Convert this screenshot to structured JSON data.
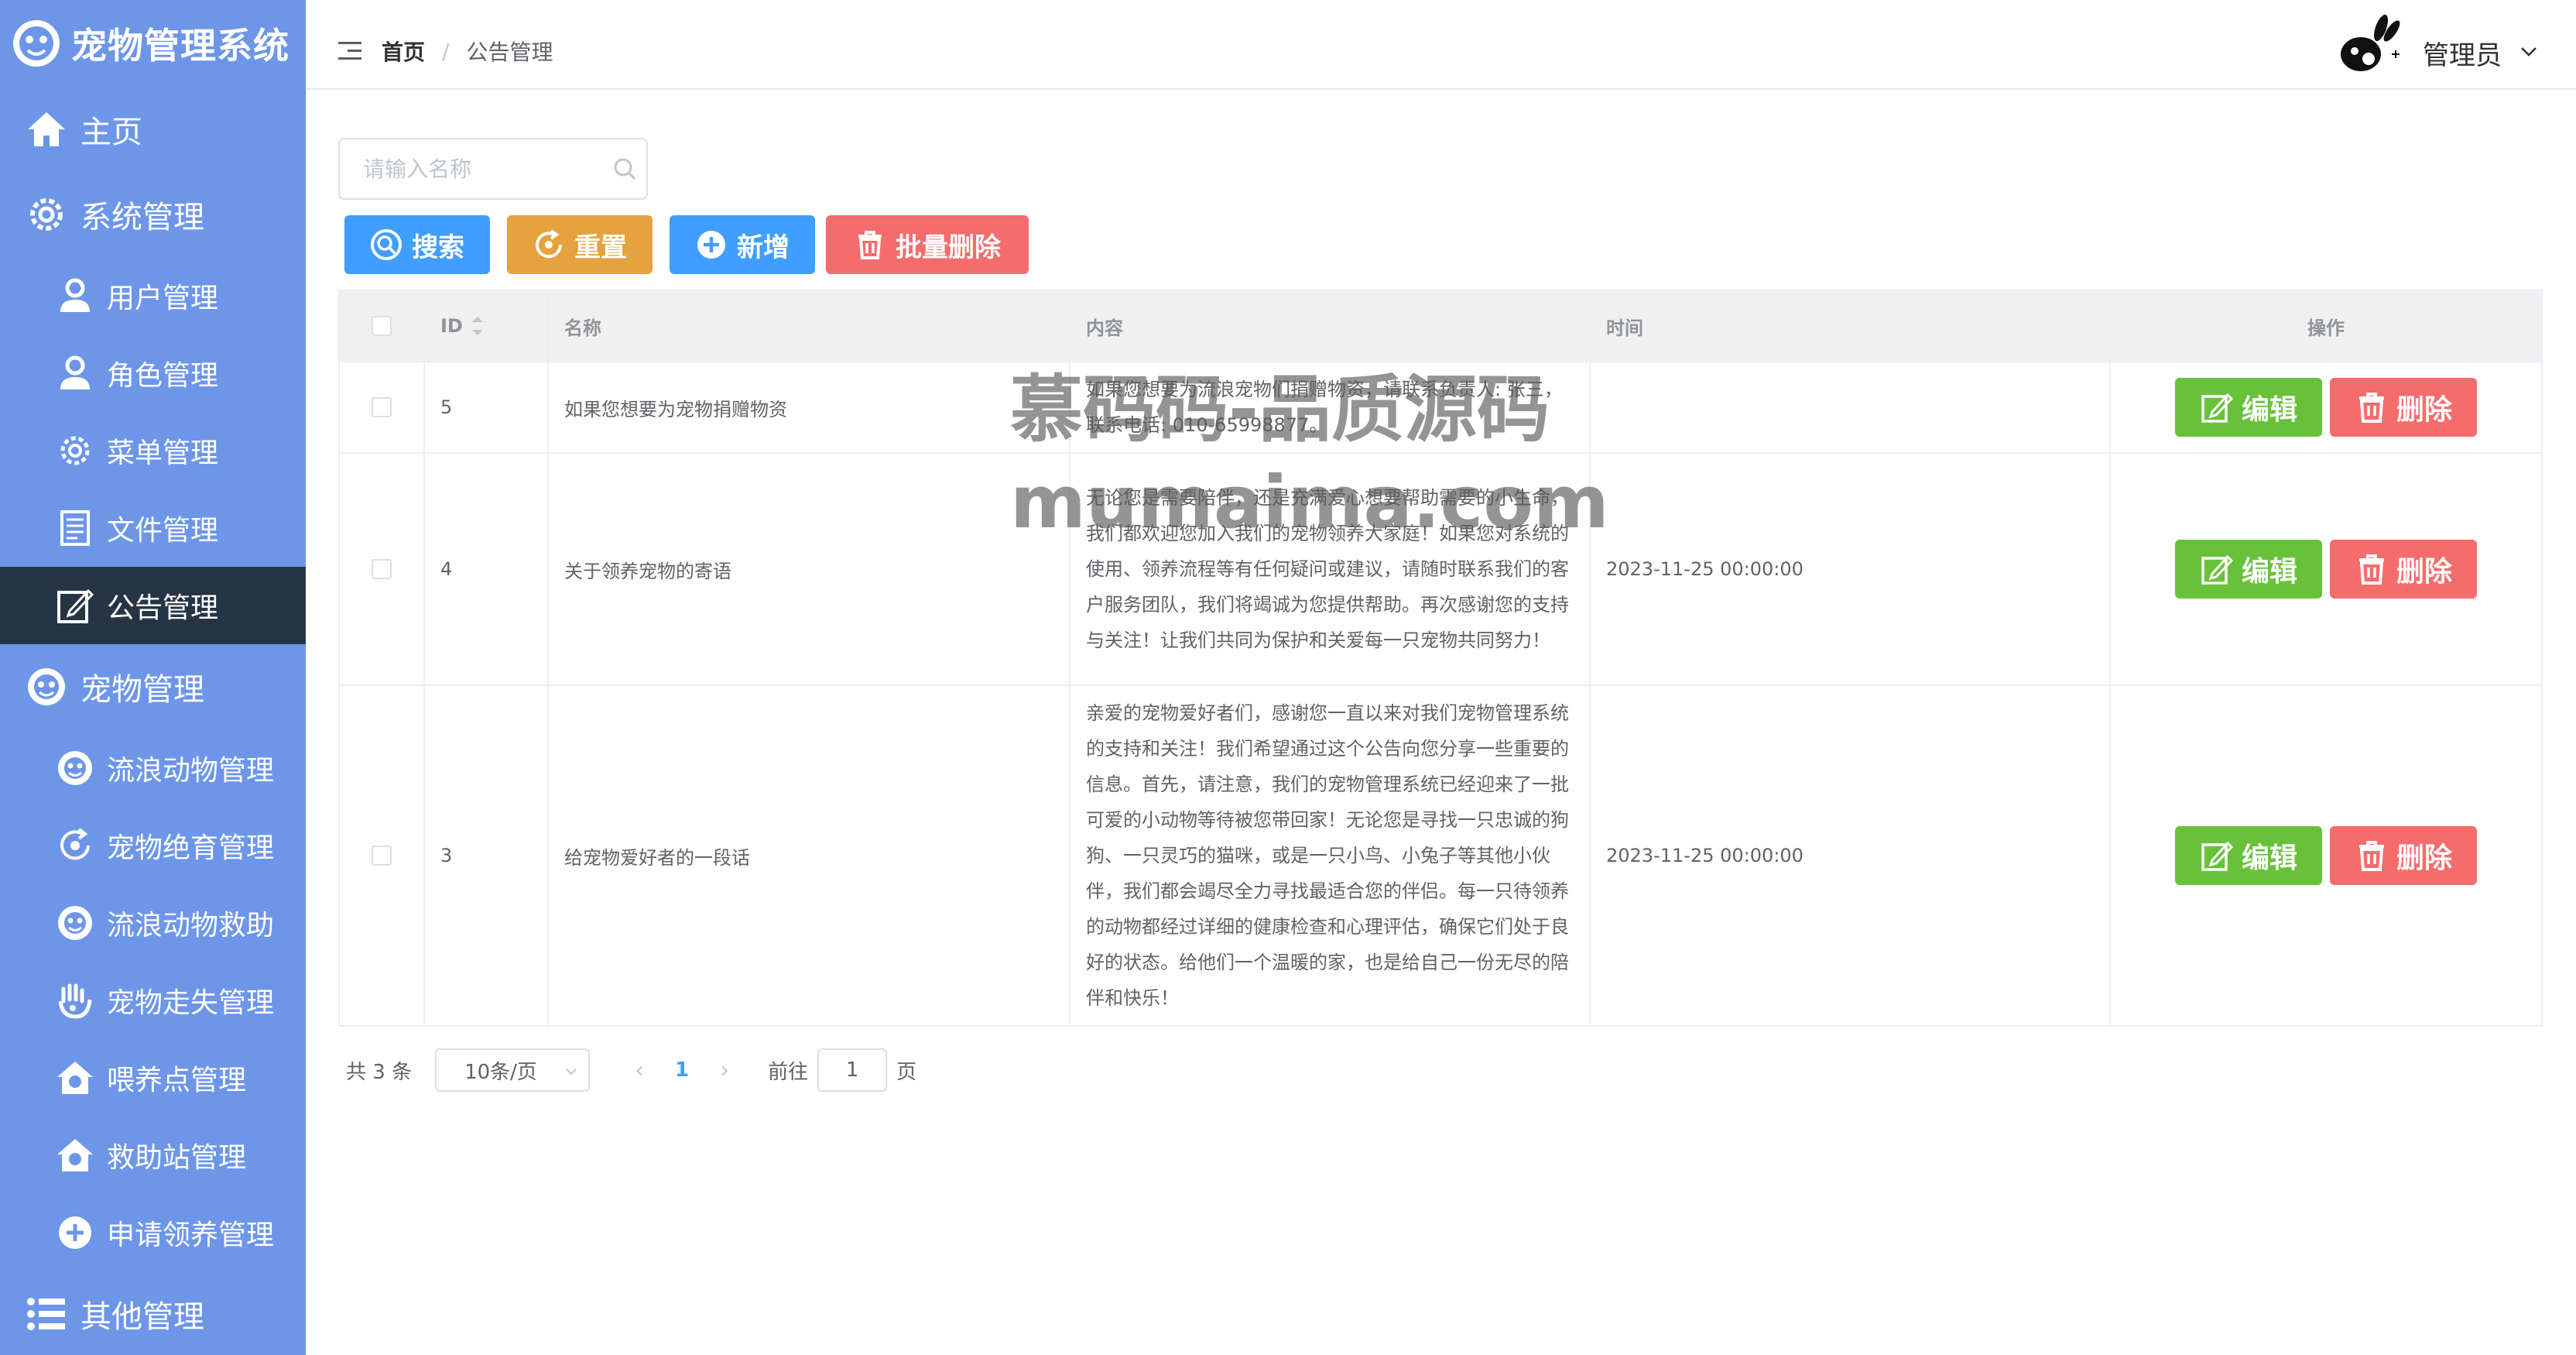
{
  "app": {
    "title": "宠物管理系统"
  },
  "sidebar": {
    "items": [
      {
        "label": "主页",
        "icon": "home-icon",
        "level": "top"
      },
      {
        "label": "系统管理",
        "icon": "gear-icon",
        "level": "top"
      },
      {
        "label": "用户管理",
        "icon": "user-icon",
        "level": "sub"
      },
      {
        "label": "角色管理",
        "icon": "user-icon",
        "level": "sub"
      },
      {
        "label": "菜单管理",
        "icon": "gear-icon",
        "level": "sub"
      },
      {
        "label": "文件管理",
        "icon": "document-icon",
        "level": "sub"
      },
      {
        "label": "公告管理",
        "icon": "edit-icon",
        "level": "sub",
        "active": true
      },
      {
        "label": "宠物管理",
        "icon": "pet-icon",
        "level": "top"
      },
      {
        "label": "流浪动物管理",
        "icon": "pet-icon",
        "level": "sub"
      },
      {
        "label": "宠物绝育管理",
        "icon": "refresh-icon",
        "level": "sub"
      },
      {
        "label": "流浪动物救助",
        "icon": "pet-icon",
        "level": "sub"
      },
      {
        "label": "宠物走失管理",
        "icon": "hand-icon",
        "level": "sub"
      },
      {
        "label": "喂养点管理",
        "icon": "house-icon",
        "level": "sub"
      },
      {
        "label": "救助站管理",
        "icon": "house-icon",
        "level": "sub"
      },
      {
        "label": "申请领养管理",
        "icon": "plus-circle-icon",
        "level": "sub"
      },
      {
        "label": "其他管理",
        "icon": "list-icon",
        "level": "top"
      }
    ]
  },
  "header": {
    "breadcrumb_home": "首页",
    "breadcrumb_sep": "/",
    "breadcrumb_current": "公告管理",
    "user_name": "管理员"
  },
  "search": {
    "placeholder": "请输入名称",
    "value": ""
  },
  "toolbar": {
    "search_label": "搜索",
    "reset_label": "重置",
    "add_label": "新增",
    "batch_delete_label": "批量删除"
  },
  "table": {
    "headers": {
      "id": "ID",
      "name": "名称",
      "content": "内容",
      "time": "时间",
      "op": "操作"
    },
    "edit_label": "编辑",
    "delete_label": "删除",
    "rows": [
      {
        "id": "5",
        "name": "如果您想要为宠物捐赠物资",
        "content": "如果您想要为流浪宠物们捐赠物资，请联系负责人: 张三，联系电话: 010-65998877。",
        "time": ""
      },
      {
        "id": "4",
        "name": "关于领养宠物的寄语",
        "content": "无论您是需要陪伴，还是充满爱心想要帮助需要的小生命，我们都欢迎您加入我们的宠物领养大家庭！如果您对系统的使用、领养流程等有任何疑问或建议，请随时联系我们的客户服务团队，我们将竭诚为您提供帮助。再次感谢您的支持与关注！让我们共同为保护和关爱每一只宠物共同努力！",
        "time": "2023-11-25 00:00:00"
      },
      {
        "id": "3",
        "name": "给宠物爱好者的一段话",
        "content": "亲爱的宠物爱好者们，感谢您一直以来对我们宠物管理系统的支持和关注！我们希望通过这个公告向您分享一些重要的信息。首先，请注意，我们的宠物管理系统已经迎来了一批可爱的小动物等待被您带回家！无论您是寻找一只忠诚的狗狗、一只灵巧的猫咪，或是一只小鸟、小兔子等其他小伙伴，我们都会竭尽全力寻找最适合您的伴侣。每一只待领养的动物都经过详细的健康检查和心理评估，确保它们处于良好的状态。给他们一个温暖的家，也是给自己一份无尽的陪伴和快乐！",
        "time": "2023-11-25 00:00:00"
      }
    ]
  },
  "pagination": {
    "total": "共 3 条",
    "page_size": "10条/页",
    "prev": "‹",
    "current": "1",
    "next": "›",
    "goto_prefix": "前往",
    "goto_value": "1",
    "goto_suffix": "页"
  },
  "watermark": {
    "line1": "慕码码-品质源码",
    "line2": "mumaima.com"
  },
  "colors": {
    "sidebar_bg": "#6d96e9",
    "sidebar_active": "#263445",
    "primary": "#409eff",
    "warning": "#e6a23c",
    "danger": "#f56c6c",
    "success": "#67c23a"
  }
}
